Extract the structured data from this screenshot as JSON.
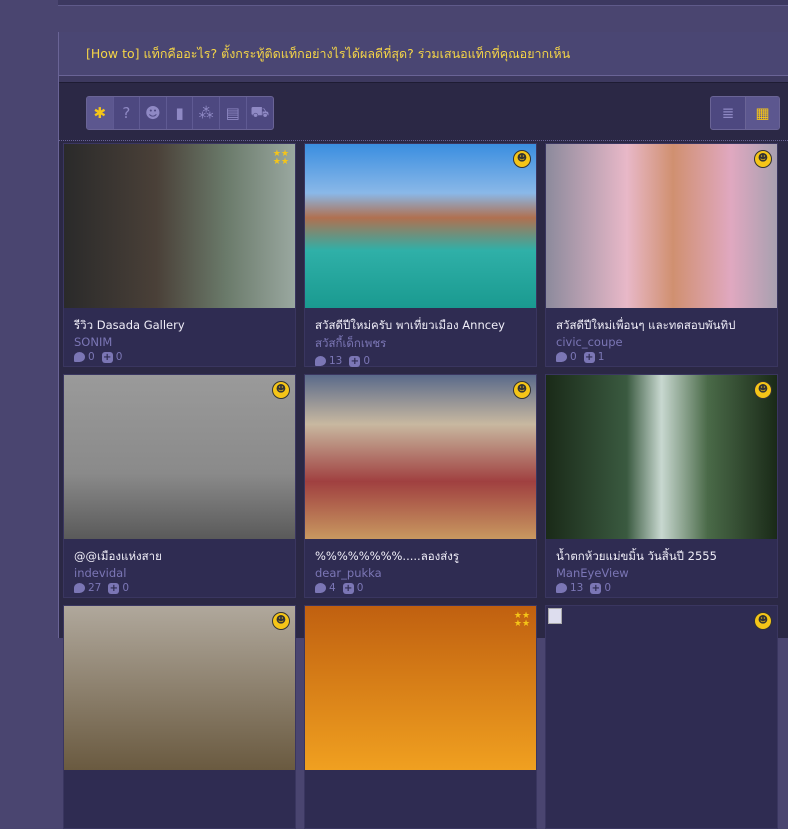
{
  "header": {
    "title_prefix": "[How to]",
    "title": " แท็กคืออะไร? ตั้งกระทู้ติดแท็กอย่างไรได้ผลดีที่สุด? ร่วมเสนอแท็กที่คุณอยากเห็น"
  },
  "filters": [
    {
      "icon": "all-icon",
      "glyph": "✱"
    },
    {
      "icon": "question-icon",
      "glyph": "?"
    },
    {
      "icon": "chat-icon",
      "glyph": "☻"
    },
    {
      "icon": "poll-icon",
      "glyph": "▮"
    },
    {
      "icon": "review-icon",
      "glyph": "⁂"
    },
    {
      "icon": "news-icon",
      "glyph": "▤"
    },
    {
      "icon": "cart-icon",
      "glyph": "⛟"
    }
  ],
  "views": [
    {
      "icon": "list-view-icon",
      "glyph": "≣"
    },
    {
      "icon": "grid-view-icon",
      "glyph": "▦"
    }
  ],
  "cards": [
    {
      "title": "รีวิว Dasada Gallery",
      "author": "SONIM",
      "comments": "0",
      "votes": "0",
      "badge": "review",
      "bg": "linear-gradient(90deg,#2a2a2a 0%,#4a4038 40%,#6a7a6a 70%,#9aa8a0 100%)"
    },
    {
      "title": "สวัสดีปีใหม่ครับ พาเที่ยวเมือง Anncey",
      "author": "สวัสกี้เด็กเพชร",
      "comments": "13",
      "votes": "0",
      "badge": "chat",
      "bg": "linear-gradient(180deg,#3a8ee0 0%,#8ab8e8 30%,#b07050 45%,#2fb0a8 65%,#1a9a90 100%)"
    },
    {
      "title": "สวัสดีปีใหม่เพื่อนๆ และทดสอบพันทิป",
      "author": "civic_coupe",
      "comments": "0",
      "votes": "1",
      "badge": "chat",
      "bg": "linear-gradient(90deg,#8c8a9c 0%,#e8b8c8 35%,#d09070 55%,#e0a8c0 80%,#a8a0b0 100%)"
    },
    {
      "title": "@@เมืองแห่งสาย",
      "author": "indevidal",
      "comments": "27",
      "votes": "0",
      "badge": "chat",
      "bg": "linear-gradient(180deg,#9a9a9a 0%,#8a8a8a 60%,#5a5a5a 100%)"
    },
    {
      "title": "%%%%%%%%.....ลองส่งรู",
      "author": "dear_pukka",
      "comments": "4",
      "votes": "0",
      "badge": "chat",
      "bg": "linear-gradient(180deg,#5a6a8a 0%,#c8b8a0 30%,#a04040 65%,#c89860 100%)"
    },
    {
      "title": "น้ำตกห้วยแม่ขมิ้น วันสิ้นปี 2555",
      "author": "ManEyeView",
      "comments": "13",
      "votes": "0",
      "badge": "chat",
      "bg": "linear-gradient(90deg,#1a2a18 0%,#3a5a40 35%,#c8d8d0 50%,#4a6a48 70%,#1a2a18 100%)"
    },
    {
      "title": "",
      "author": "",
      "comments": "",
      "votes": "",
      "badge": "chat",
      "bg": "linear-gradient(180deg,#b0a89c,#6a5a40)"
    },
    {
      "title": "",
      "author": "",
      "comments": "",
      "votes": "",
      "badge": "review",
      "bg": "linear-gradient(180deg,#c06010,#f0a020)"
    },
    {
      "title": "",
      "author": "",
      "comments": "",
      "votes": "",
      "badge": "chat",
      "bg": "#2f2c52",
      "broken": true
    }
  ]
}
